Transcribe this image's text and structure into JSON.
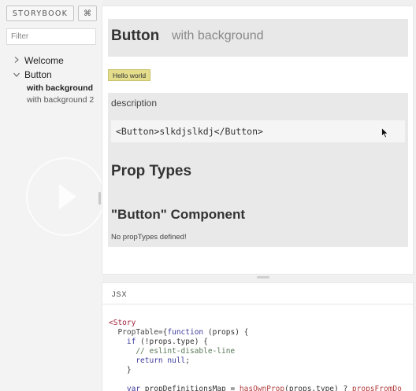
{
  "sidebar": {
    "brand_label": "STORYBOOK",
    "shortcut_label": "⌘",
    "filter_placeholder": "Filter",
    "kinds": [
      {
        "label": "Welcome",
        "expanded": false
      },
      {
        "label": "Button",
        "expanded": true
      }
    ],
    "stories": [
      {
        "label": "with background",
        "active": true
      },
      {
        "label": "with background 2",
        "active": false
      }
    ]
  },
  "preview": {
    "title": "Button",
    "subtitle": "with background",
    "hello_button": "Hello world",
    "description_label": "description",
    "usage_code": "<Button>slkdjslkdj</Button>",
    "prop_types_heading": "Prop Types",
    "component_heading": "\"Button\" Component",
    "no_prop_types": "No propTypes defined!"
  },
  "addon_panel": {
    "tab_label": "JSX",
    "code": {
      "l1_tag": "<Story",
      "l2_attr": "PropTable=",
      "l2_brace": "{",
      "l2_kw": "function",
      "l2_rest": " (props) {",
      "l3_kw": "if",
      "l3_rest": " (!props.type) {",
      "l4_comment": "// eslint-disable-line",
      "l5_kw": "return",
      "l5_kw2": "null",
      "l5_semi": ";",
      "l6": "}",
      "l7_kw": "var",
      "l7_mid": " propDefinitionsMap = ",
      "l7_fn": "hasOwnProp",
      "l7_rest": "(props.type) ? ",
      "l7_fn2": "propsFromDo"
    }
  },
  "colors": {
    "background": "#f0f0f0",
    "title_bar": "#e8e8e8",
    "info_panel": "#e9e9e9",
    "hello_button": "#e4dd8c",
    "code_tag": "#a0223a",
    "code_keyword": "#3b3b9b"
  }
}
